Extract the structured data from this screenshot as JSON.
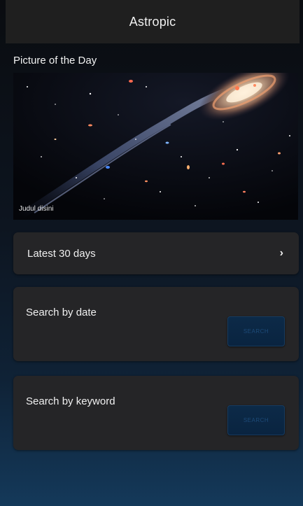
{
  "appbar": {
    "title": "Astropic"
  },
  "potd": {
    "section_title": "Picture of the Day",
    "caption": "Judul disini"
  },
  "menu": {
    "latest_label": "Latest 30 days",
    "latest_icon": "chevron-right-icon",
    "search_by_date": {
      "title": "Search by date",
      "button_label": "SEARCH"
    },
    "search_by_keyword": {
      "title": "Search by keyword",
      "button_label": "SEARCH"
    }
  },
  "colors": {
    "appbar": "#1f1f1f",
    "card": "#252527",
    "button": "#0c2a48",
    "background_bottom": "#14395a"
  }
}
